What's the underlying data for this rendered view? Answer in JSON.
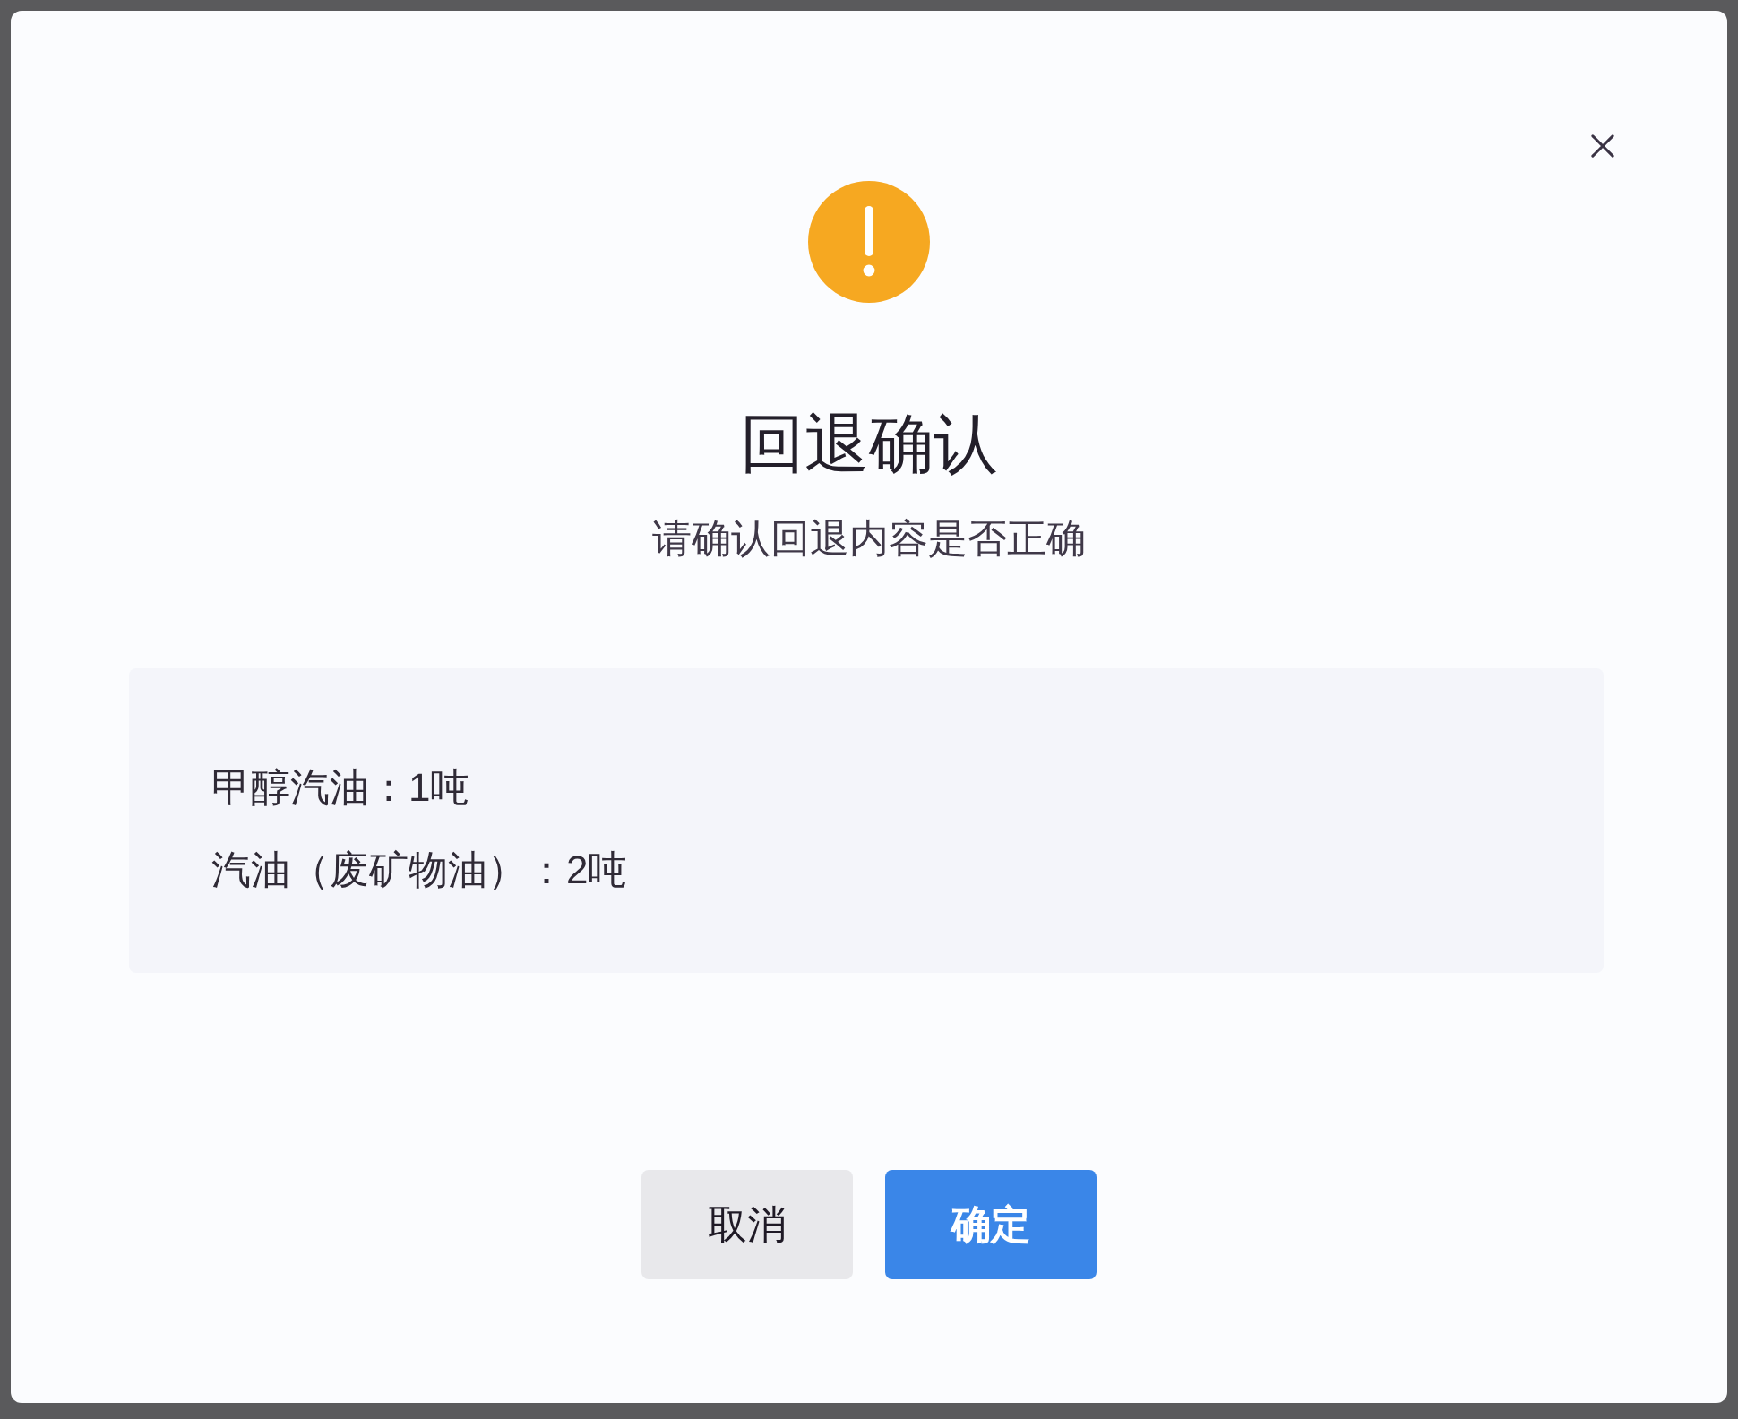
{
  "dialog": {
    "title": "回退确认",
    "subtitle": "请确认回退内容是否正确",
    "items": [
      "甲醇汽油：1吨",
      "汽油（废矿物油）：2吨"
    ],
    "buttons": [
      {
        "label": "取消",
        "kind": "secondary"
      },
      {
        "label": "确定",
        "kind": "primary"
      }
    ]
  }
}
